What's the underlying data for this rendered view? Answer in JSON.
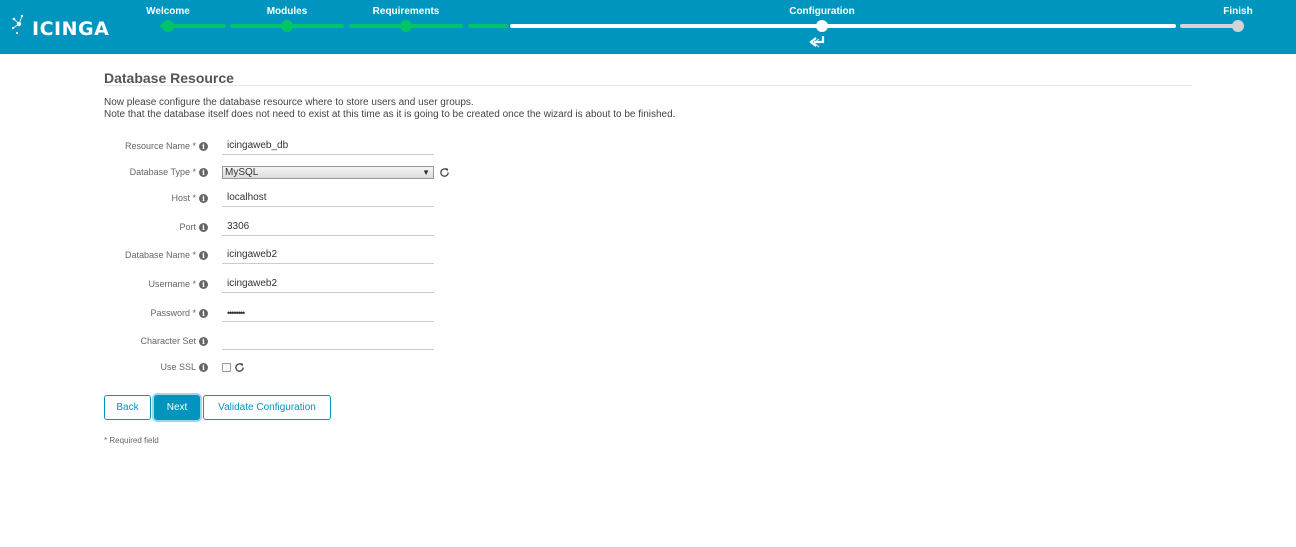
{
  "header": {
    "logo_text": "ICINGA",
    "steps": [
      {
        "label": "Welcome",
        "state": "done"
      },
      {
        "label": "Modules",
        "state": "done"
      },
      {
        "label": "Requirements",
        "state": "done"
      },
      {
        "label": "Configuration",
        "state": "current"
      },
      {
        "label": "Finish",
        "state": "todo"
      }
    ],
    "colors": {
      "bar": "#0095bf",
      "done": "#00c36a",
      "current": "#ffffff",
      "pending": "#d3d3d3"
    }
  },
  "page": {
    "title": "Database Resource",
    "intro_line1": "Now please configure the database resource where to store users and user groups.",
    "intro_line2": "Note that the database itself does not need to exist at this time as it is going to be created once the wizard is about to be finished."
  },
  "form": {
    "resource_name": {
      "label": "Resource Name *",
      "value": "icingaweb_db"
    },
    "database_type": {
      "label": "Database Type *",
      "value": "MySQL"
    },
    "host": {
      "label": "Host *",
      "value": "localhost"
    },
    "port": {
      "label": "Port",
      "value": "3306"
    },
    "database_name": {
      "label": "Database Name *",
      "value": "icingaweb2"
    },
    "username": {
      "label": "Username *",
      "value": "icingaweb2"
    },
    "password": {
      "label": "Password *",
      "value": "••••••••"
    },
    "character_set": {
      "label": "Character Set",
      "value": ""
    },
    "use_ssl": {
      "label": "Use SSL",
      "checked": false
    }
  },
  "buttons": {
    "back": "Back",
    "next": "Next",
    "validate": "Validate Configuration"
  },
  "footer": {
    "required_note": "* Required field"
  }
}
